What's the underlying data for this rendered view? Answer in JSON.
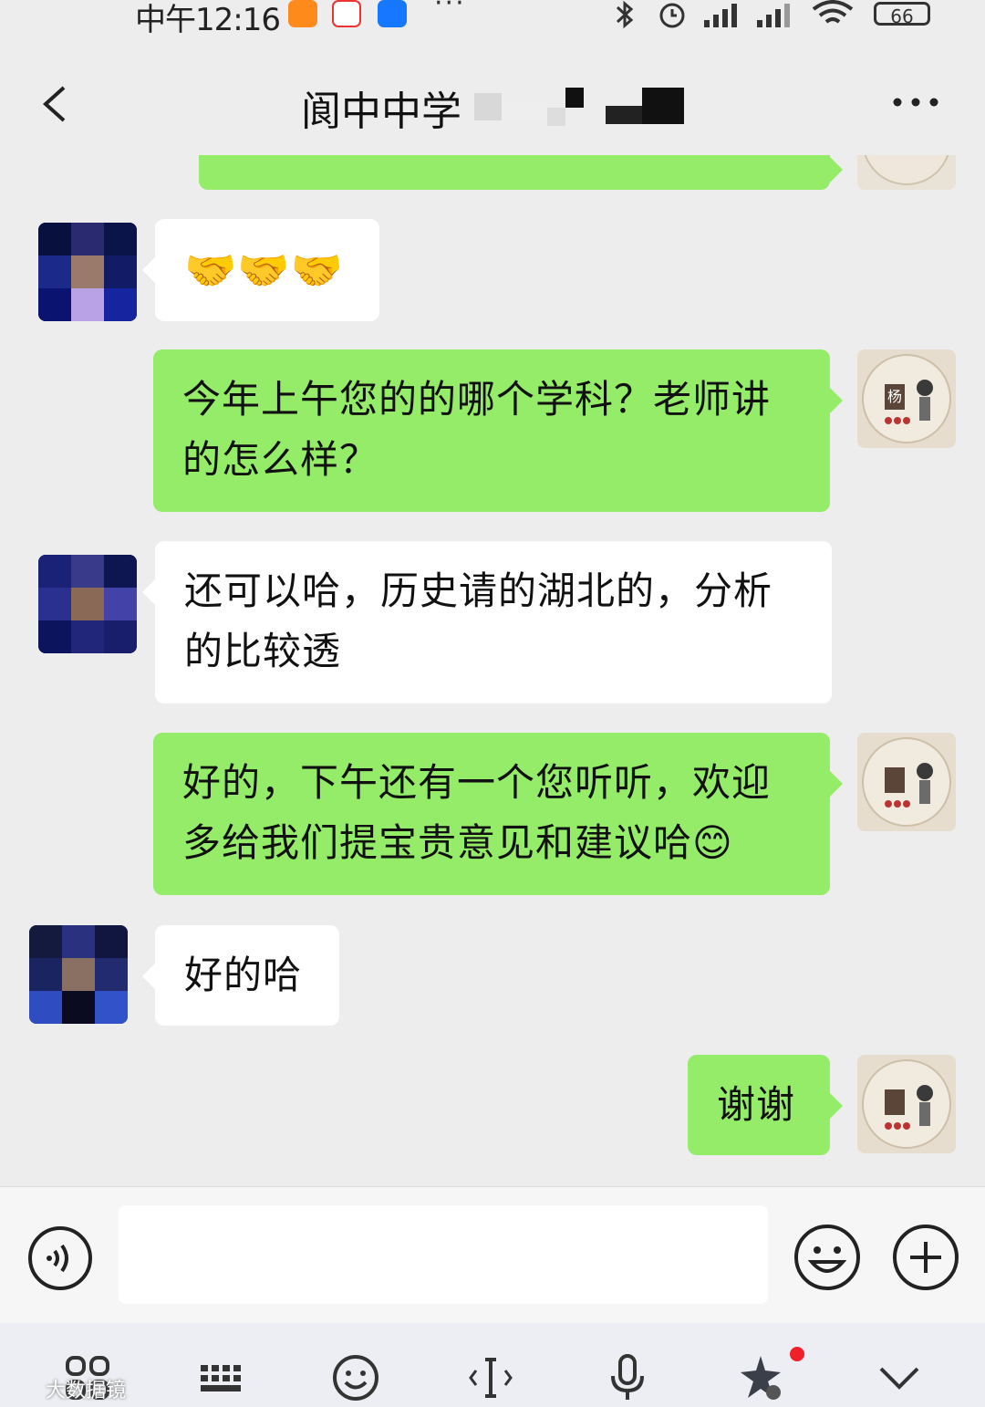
{
  "status_bar": {
    "time": "中午12:16",
    "battery": "66",
    "app_icons": [
      "taobao-icon",
      "jd-icon",
      "alipay-icon"
    ],
    "more": "···"
  },
  "header": {
    "title": "阆中中学",
    "back_icon": "chevron-left-icon",
    "more_icon": "more-dots-icon"
  },
  "messages": [
    {
      "from": "me",
      "text": "",
      "partial": true
    },
    {
      "from": "other",
      "text": "🤝🤝🤝"
    },
    {
      "from": "me",
      "lines": [
        "今年上午您的的哪个学科？老师讲",
        "的怎么样？"
      ]
    },
    {
      "from": "other",
      "lines": [
        "还可以哈，历史请的湖北的，分析",
        "的比较透"
      ]
    },
    {
      "from": "me",
      "lines": [
        "好的，下午还有一个您听听，欢迎",
        "多给我们提宝贵意见和建议哈😊"
      ]
    },
    {
      "from": "other",
      "text": "好的哈"
    },
    {
      "from": "me",
      "text": "谢谢"
    }
  ],
  "my_avatar": {
    "char": "杨"
  },
  "input_bar": {
    "placeholder": "",
    "voice_icon": "voice-icon",
    "emoji_icon": "emoji-icon",
    "plus_icon": "plus-icon"
  },
  "keyboard_toolbar": {
    "icons": [
      "apps-icon",
      "keyboard-icon",
      "emoji-smile-icon",
      "cursor-icon",
      "microphone-icon",
      "ai-sparkle-icon",
      "collapse-icon"
    ],
    "watermark": "大数据镜"
  },
  "colors": {
    "outgoing_bubble": "#95ec69",
    "incoming_bubble": "#ffffff",
    "background": "#ededed"
  }
}
